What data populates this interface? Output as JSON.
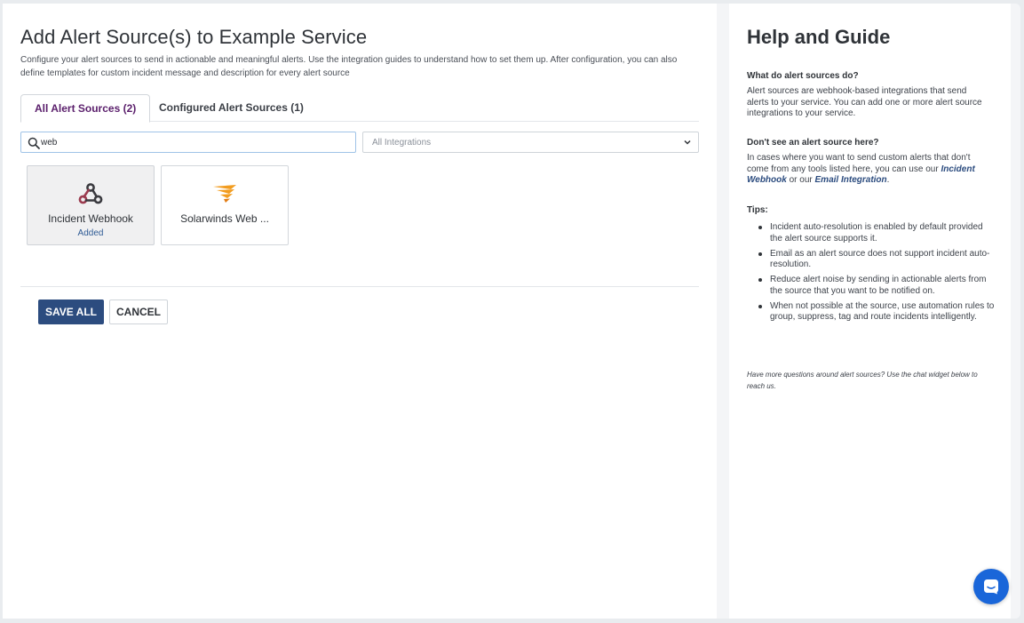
{
  "main": {
    "title": "Add Alert Source(s) to Example Service",
    "description": "Configure your alert sources to send in actionable and meaningful alerts. Use the integration guides to understand how to set them up. After configuration, you can also define templates for custom incident message and description for every alert source",
    "tabs": [
      {
        "label": "All Alert Sources (2)",
        "active": true
      },
      {
        "label": "Configured Alert Sources (1)",
        "active": false
      }
    ],
    "search": {
      "value": "web",
      "icon": "search-icon"
    },
    "integration_filter": {
      "selected": "All Integrations",
      "icon": "chevron-down-icon"
    },
    "cards": [
      {
        "name": "Incident Webhook",
        "status": "Added",
        "icon": "webhook-icon",
        "color": "#9b3b4f"
      },
      {
        "name": "Solarwinds Web ...",
        "status": "",
        "icon": "solarwinds-icon",
        "color": "#f29c1f"
      }
    ],
    "buttons": {
      "save": "SAVE ALL",
      "cancel": "CANCEL"
    }
  },
  "help": {
    "title": "Help and Guide",
    "q1": "What do alert sources do?",
    "a1": "Alert sources are webhook-based integrations that send alerts to your service. You can add one or more alert source integrations to your service.",
    "q2": "Don't see an alert source here?",
    "a2_prefix": "In cases where you want to send custom alerts that don't come from any tools listed here, you can use our",
    "a2_link1": "Incident Webhook",
    "a2_mid": "or our",
    "a2_link2": "Email Integration",
    "a2_suffix": ".",
    "tips_title": "Tips:",
    "tips": [
      "Incident auto-resolution is enabled by default provided the alert source supports it.",
      "Email as an alert source does not support incident auto-resolution.",
      "Reduce alert noise by sending in actionable alerts from the source that you want to be notified on.",
      "When not possible at the source, use automation rules to group, suppress, tag and route incidents intelligently."
    ],
    "footer": "Have more questions around alert sources? Use the chat widget below to reach us."
  },
  "chat": {
    "icon": "chat-icon",
    "color": "#1a66d9"
  }
}
